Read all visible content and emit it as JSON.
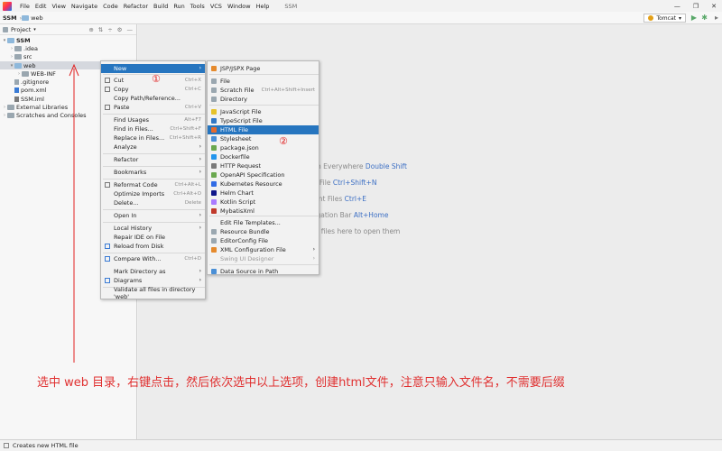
{
  "titlebar": {
    "menu": [
      "File",
      "Edit",
      "View",
      "Navigate",
      "Code",
      "Refactor",
      "Build",
      "Run",
      "Tools",
      "VCS",
      "Window",
      "Help"
    ],
    "title": "SSM"
  },
  "navbar": {
    "project": "SSM",
    "folder": "web",
    "run_config": "Tomcat"
  },
  "project_panel": {
    "title": "Project",
    "tree": [
      {
        "label": "SSM",
        "indent": 0,
        "arrow": "▾",
        "bold": true
      },
      {
        "label": ".idea",
        "indent": 1,
        "arrow": "›"
      },
      {
        "label": "src",
        "indent": 1,
        "arrow": "›"
      },
      {
        "label": "web",
        "indent": 1,
        "arrow": "▾",
        "selected": true
      },
      {
        "label": "WEB-INF",
        "indent": 2,
        "arrow": "›"
      },
      {
        "label": ".gitignore",
        "indent": 1,
        "arrow": ""
      },
      {
        "label": "pom.xml",
        "indent": 1,
        "arrow": ""
      },
      {
        "label": "SSM.iml",
        "indent": 1,
        "arrow": ""
      },
      {
        "label": "External Libraries",
        "indent": 0,
        "arrow": "›"
      },
      {
        "label": "Scratches and Consoles",
        "indent": 0,
        "arrow": "›"
      }
    ]
  },
  "editor_hints": [
    {
      "text": "rch Everywhere",
      "key": "Double Shift"
    },
    {
      "text": "to File",
      "key": "Ctrl+Shift+N"
    },
    {
      "text": "cent Files",
      "key": "Ctrl+E"
    },
    {
      "text": "vigation Bar",
      "key": "Alt+Home"
    },
    {
      "text": "op files here to open them",
      "key": ""
    }
  ],
  "context_menu": {
    "items": [
      {
        "label": "New",
        "shortcut": "",
        "submenu": true,
        "active": true
      },
      {
        "label": "Cut",
        "shortcut": "Ctrl+X"
      },
      {
        "label": "Copy",
        "shortcut": "Ctrl+C"
      },
      {
        "label": "Copy Path/Reference...",
        "shortcut": ""
      },
      {
        "label": "Paste",
        "shortcut": "Ctrl+V"
      },
      {
        "label": "Find Usages",
        "shortcut": "Alt+F7"
      },
      {
        "label": "Find in Files...",
        "shortcut": "Ctrl+Shift+F"
      },
      {
        "label": "Replace in Files...",
        "shortcut": "Ctrl+Shift+R"
      },
      {
        "label": "Analyze",
        "shortcut": "",
        "submenu": true
      },
      {
        "label": "Refactor",
        "shortcut": "",
        "submenu": true
      },
      {
        "label": "Bookmarks",
        "shortcut": "",
        "submenu": true
      },
      {
        "label": "Reformat Code",
        "shortcut": "Ctrl+Alt+L"
      },
      {
        "label": "Optimize Imports",
        "shortcut": "Ctrl+Alt+O"
      },
      {
        "label": "Delete...",
        "shortcut": "Delete"
      },
      {
        "label": "Open In",
        "shortcut": "",
        "submenu": true
      },
      {
        "label": "Local History",
        "shortcut": "",
        "submenu": true
      },
      {
        "label": "Repair IDE on File",
        "shortcut": ""
      },
      {
        "label": "Reload from Disk",
        "shortcut": ""
      },
      {
        "label": "Compare With...",
        "shortcut": "Ctrl+D"
      },
      {
        "label": "Mark Directory as",
        "shortcut": "",
        "submenu": true
      },
      {
        "label": "Diagrams",
        "shortcut": "",
        "submenu": true
      },
      {
        "label": "Validate all files in directory 'web'",
        "shortcut": ""
      }
    ]
  },
  "new_submenu": {
    "items": [
      {
        "label": "JSP/JSPX Page",
        "color": "#e58a2d"
      },
      {
        "label": "File",
        "color": "#9aa7b0"
      },
      {
        "label": "Scratch File",
        "shortcut": "Ctrl+Alt+Shift+Insert",
        "color": "#9aa7b0"
      },
      {
        "label": "Directory",
        "color": "#9aa7b0"
      },
      {
        "label": "JavaScript File",
        "color": "#e6c229"
      },
      {
        "label": "TypeScript File",
        "color": "#3178c6"
      },
      {
        "label": "HTML File",
        "color": "#e66b2d",
        "active": true
      },
      {
        "label": "Stylesheet",
        "color": "#4a8fd6"
      },
      {
        "label": "package.json",
        "color": "#6aa84f"
      },
      {
        "label": "Dockerfile",
        "color": "#2496ed"
      },
      {
        "label": "HTTP Request",
        "color": "#7a7a7a"
      },
      {
        "label": "OpenAPI Specification",
        "color": "#6aa84f"
      },
      {
        "label": "Kubernetes Resource",
        "color": "#326ce5"
      },
      {
        "label": "Helm Chart",
        "color": "#0f1689"
      },
      {
        "label": "Kotlin Script",
        "color": "#a97bff"
      },
      {
        "label": "MybatisXml",
        "color": "#c0392b"
      },
      {
        "label": "Edit File Templates...",
        "color": ""
      },
      {
        "label": "Resource Bundle",
        "color": "#9aa7b0"
      },
      {
        "label": "EditorConfig File",
        "color": "#9aa7b0"
      },
      {
        "label": "XML Configuration File",
        "submenu": true,
        "color": "#e58a2d"
      },
      {
        "label": "Swing UI Designer",
        "submenu": true,
        "disabled": true,
        "color": ""
      },
      {
        "label": "Data Source in Path",
        "color": "#4a8fd6"
      }
    ]
  },
  "markers": {
    "one": "①",
    "two": "②"
  },
  "annotation": "选中 web 目录，右键点击，然后依次选中以上选项，创建html文件，注意只输入文件名，不需要后缀",
  "status": {
    "text": "Creates new HTML file"
  }
}
